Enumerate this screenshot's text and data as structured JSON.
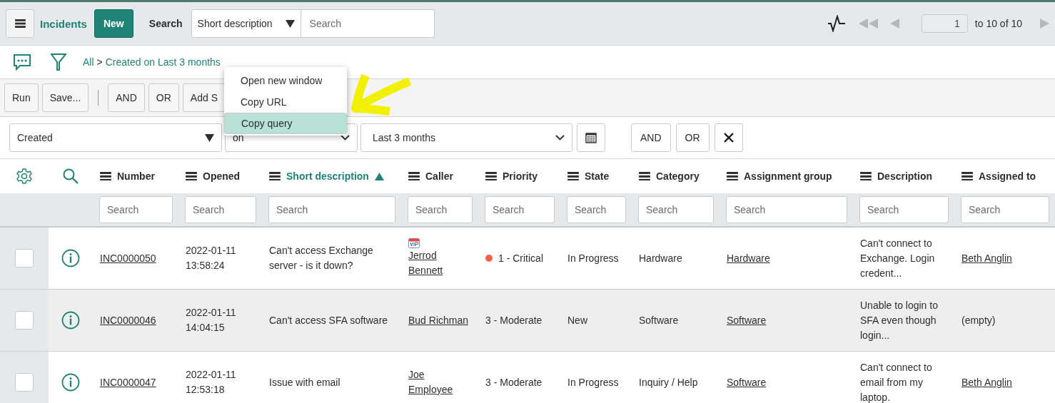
{
  "toolbar": {
    "title": "Incidents",
    "new_button": "New",
    "search_label": "Search",
    "search_field": "Short description",
    "search_placeholder": "Search",
    "page": "1",
    "page_range": "to 10 of 10"
  },
  "breadcrumb": {
    "items": [
      "All",
      "Created on Last 3 months"
    ],
    "separator": ">"
  },
  "filter_buttons": [
    "Run",
    "Save...",
    "AND",
    "OR",
    "Add S"
  ],
  "context_menu": [
    {
      "label": "Open new window",
      "selected": false
    },
    {
      "label": "Copy URL",
      "selected": false
    },
    {
      "label": "Copy query",
      "selected": true
    }
  ],
  "condition": {
    "field": "Created",
    "operator": "on",
    "value": "Last 3 months",
    "buttons": [
      "AND",
      "OR"
    ]
  },
  "table": {
    "columns": [
      {
        "label": "Number",
        "sorted": false,
        "placeholder": "Search"
      },
      {
        "label": "Opened",
        "sorted": false,
        "placeholder": "Search"
      },
      {
        "label": "Short description",
        "sorted": true,
        "placeholder": "Search"
      },
      {
        "label": "Caller",
        "sorted": false,
        "placeholder": "Search"
      },
      {
        "label": "Priority",
        "sorted": false,
        "placeholder": "Search"
      },
      {
        "label": "State",
        "sorted": false,
        "placeholder": "Search"
      },
      {
        "label": "Category",
        "sorted": false,
        "placeholder": "Search"
      },
      {
        "label": "Assignment group",
        "sorted": false,
        "placeholder": "Search"
      },
      {
        "label": "Description",
        "sorted": false,
        "placeholder": "Search"
      },
      {
        "label": "Assigned to",
        "sorted": false,
        "placeholder": "Search"
      }
    ],
    "rows": [
      {
        "checked": false,
        "highlighted": false,
        "cells": [
          {
            "kind": "link",
            "text": "INC0000050"
          },
          {
            "kind": "text",
            "text": "2022-01-11 13:58:24"
          },
          {
            "kind": "text",
            "text": "Can't access Exchange server - is it down?"
          },
          {
            "kind": "link",
            "text": "Jerrod Bennett",
            "vip": true
          },
          {
            "kind": "text",
            "text": "1 - Critical",
            "color": "#f95f45"
          },
          {
            "kind": "text",
            "text": "In Progress"
          },
          {
            "kind": "text",
            "text": "Hardware"
          },
          {
            "kind": "link",
            "text": "Hardware"
          },
          {
            "kind": "text",
            "text": "Can't connect to Exchange. Login credent..."
          },
          {
            "kind": "link",
            "text": "Beth Anglin"
          }
        ]
      },
      {
        "checked": false,
        "highlighted": true,
        "cells": [
          {
            "kind": "link",
            "text": "INC0000046"
          },
          {
            "kind": "text",
            "text": "2022-01-11 14:04:15"
          },
          {
            "kind": "text",
            "text": "Can't access SFA software"
          },
          {
            "kind": "link",
            "text": "Bud Richman"
          },
          {
            "kind": "text",
            "text": "3 - Moderate"
          },
          {
            "kind": "text",
            "text": "New"
          },
          {
            "kind": "text",
            "text": "Software"
          },
          {
            "kind": "link",
            "text": "Software"
          },
          {
            "kind": "text",
            "text": "Unable to login to SFA even though login..."
          },
          {
            "kind": "text",
            "text": "(empty)"
          }
        ]
      },
      {
        "checked": false,
        "highlighted": false,
        "cells": [
          {
            "kind": "link",
            "text": "INC0000047"
          },
          {
            "kind": "text",
            "text": "2022-01-11 12:53:18"
          },
          {
            "kind": "text",
            "text": "Issue with email"
          },
          {
            "kind": "link",
            "text": "Joe Employee"
          },
          {
            "kind": "text",
            "text": "3 - Moderate"
          },
          {
            "kind": "text",
            "text": "In Progress"
          },
          {
            "kind": "text",
            "text": "Inquiry / Help"
          },
          {
            "kind": "link",
            "text": "Software"
          },
          {
            "kind": "text",
            "text": "Can't connect to email from my laptop."
          },
          {
            "kind": "link",
            "text": "Beth Anglin"
          }
        ]
      }
    ]
  }
}
